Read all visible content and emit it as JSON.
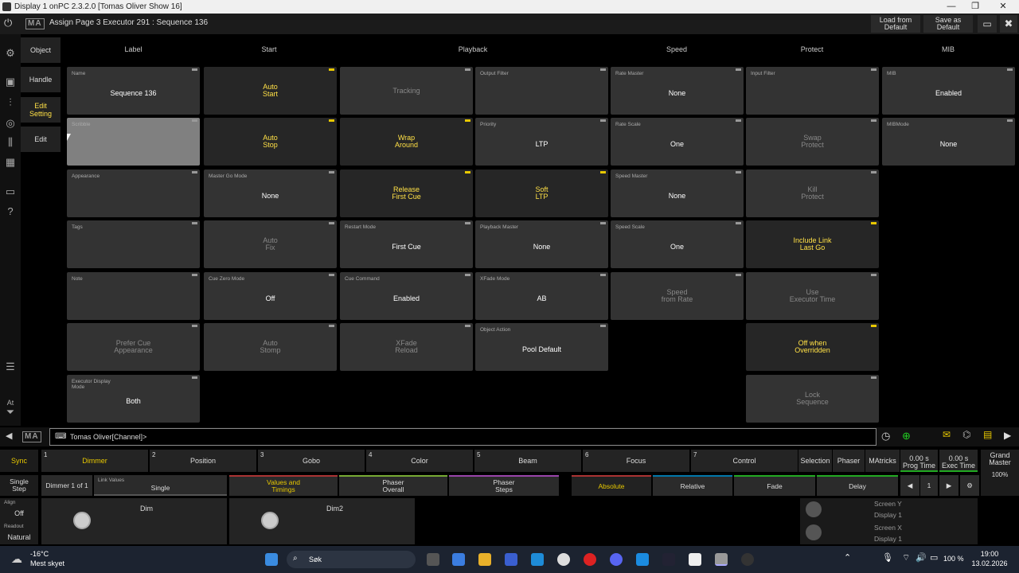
{
  "window": {
    "title": "Display 1 onPC 2.3.2.0 [Tomas Oliver Show 16]",
    "min": "—",
    "max": "❐",
    "close": "✕"
  },
  "header": {
    "logo": "MA",
    "title": "Assign Page 3 Executor 291 : Sequence 136",
    "load_default": "Load from\nDefault",
    "save_default": "Save as\nDefault"
  },
  "tabs": [
    {
      "label": "Object"
    },
    {
      "label": "Handle"
    },
    {
      "label": "Edit\nSetting"
    },
    {
      "label": "Edit"
    }
  ],
  "columns": [
    "Label",
    "Start",
    "Playback",
    "Speed",
    "Protect",
    "MIB"
  ],
  "cells": {
    "c0": [
      {
        "label": "Name",
        "value": "Sequence 136",
        "tone": "w"
      },
      {
        "label": "Scribble",
        "value": "",
        "tone": "w",
        "sel": true
      },
      {
        "label": "Appearance",
        "value": "",
        "tone": "w"
      },
      {
        "label": "Tags",
        "value": "",
        "tone": "w"
      },
      {
        "label": "Note",
        "value": "",
        "tone": "w"
      },
      {
        "label": "",
        "value": "Prefer Cue\nAppearance",
        "tone": "g"
      },
      {
        "label": "Executor Display\nMode",
        "value": "Both",
        "tone": "w"
      }
    ],
    "c1": [
      {
        "label": "",
        "value": "Auto\nStart",
        "tone": "y",
        "dark": true
      },
      {
        "label": "",
        "value": "Auto\nStop",
        "tone": "y",
        "dark": true
      },
      {
        "label": "Master Go Mode",
        "value": "None",
        "tone": "w"
      },
      {
        "label": "",
        "value": "Auto\nFix",
        "tone": "g"
      },
      {
        "label": "Cue Zero Mode",
        "value": "Off",
        "tone": "w"
      },
      {
        "label": "",
        "value": "Auto\nStomp",
        "tone": "g"
      }
    ],
    "c2": [
      {
        "label": "",
        "value": "Tracking",
        "tone": "g"
      },
      {
        "label": "",
        "value": "Wrap\nAround",
        "tone": "y",
        "dark": true
      },
      {
        "label": "",
        "value": "Release\nFirst Cue",
        "tone": "y",
        "dark": true
      },
      {
        "label": "Restart Mode",
        "value": "First Cue",
        "tone": "w"
      },
      {
        "label": "Cue Command",
        "value": "Enabled",
        "tone": "w"
      },
      {
        "label": "",
        "value": "XFade\nReload",
        "tone": "g"
      }
    ],
    "c3": [
      {
        "label": "Output Filter",
        "value": "",
        "tone": "w"
      },
      {
        "label": "Priority",
        "value": "LTP",
        "tone": "w"
      },
      {
        "label": "",
        "value": "Soft\nLTP",
        "tone": "y",
        "dark": true
      },
      {
        "label": "Playback Master",
        "value": "None",
        "tone": "w"
      },
      {
        "label": "XFade Mode",
        "value": "AB",
        "tone": "w"
      },
      {
        "label": "Object Action",
        "value": "Pool Default",
        "tone": "w"
      }
    ],
    "c4": [
      {
        "label": "Rate Master",
        "value": "None",
        "tone": "w"
      },
      {
        "label": "Rate Scale",
        "value": "One",
        "tone": "w"
      },
      {
        "label": "Speed Master",
        "value": "None",
        "tone": "w"
      },
      {
        "label": "Speed Scale",
        "value": "One",
        "tone": "w"
      },
      {
        "label": "",
        "value": "Speed\nfrom Rate",
        "tone": "g"
      }
    ],
    "c5": [
      {
        "label": "Input Filter",
        "value": "",
        "tone": "w"
      },
      {
        "label": "",
        "value": "Swap\nProtect",
        "tone": "g"
      },
      {
        "label": "",
        "value": "Kill\nProtect",
        "tone": "g"
      },
      {
        "label": "",
        "value": "Include Link\nLast Go",
        "tone": "y",
        "dark": true
      },
      {
        "label": "",
        "value": "Use\nExecutor Time",
        "tone": "g"
      },
      {
        "label": "",
        "value": "Off when\nOverridden",
        "tone": "y",
        "dark": true
      },
      {
        "label": "",
        "value": "Lock\nSequence",
        "tone": "g"
      }
    ],
    "c6": [
      {
        "label": "MIB",
        "value": "Enabled",
        "tone": "w"
      },
      {
        "label": "MIBMode",
        "value": "None",
        "tone": "w"
      }
    ]
  },
  "command": {
    "logo": "MA",
    "prompt": "Tomas Oliver[Channel]>"
  },
  "presets": {
    "sync": "Sync",
    "items": [
      {
        "n": "1",
        "label": "Dimmer"
      },
      {
        "n": "2",
        "label": "Position"
      },
      {
        "n": "3",
        "label": "Gobo"
      },
      {
        "n": "4",
        "label": "Color"
      },
      {
        "n": "5",
        "label": "Beam"
      },
      {
        "n": "6",
        "label": "Focus"
      },
      {
        "n": "7",
        "label": "Control"
      }
    ],
    "selection": "Selection",
    "phaser": "Phaser",
    "matricks": "MAtricks",
    "prog_time_val": "0.00 s",
    "prog_time": "Prog Time",
    "exec_time_val": "0.00 s",
    "exec_time": "Exec Time",
    "grand_master": "Grand\nMaster",
    "gm_value": "100%"
  },
  "bottom": {
    "single_step": "Single\nStep",
    "dimmer_page": "Dimmer 1 of 1",
    "link_values_lbl": "Link Values",
    "link_values": "Single",
    "values_timings": "Values and\nTimings",
    "phaser_overall": "Phaser\nOverall",
    "phaser_steps": "Phaser\nSteps",
    "absolute": "Absolute",
    "relative": "Relative",
    "fade": "Fade",
    "delay": "Delay",
    "page_num": "1"
  },
  "encoders": {
    "align_lbl": "Align",
    "align": "Off",
    "readout_lbl": "Readout",
    "readout": "Natural",
    "dim": "Dim",
    "dim2": "Dim2",
    "screen_y": "Screen Y",
    "display1a": "Display 1",
    "screen_x": "Screen X",
    "display1b": "Display 1"
  },
  "taskbar": {
    "temp": "-16°C",
    "weather": "Mest skyet",
    "search": "Søk",
    "battery": "100 %",
    "time": "19:00",
    "date": "13.02.2026"
  }
}
